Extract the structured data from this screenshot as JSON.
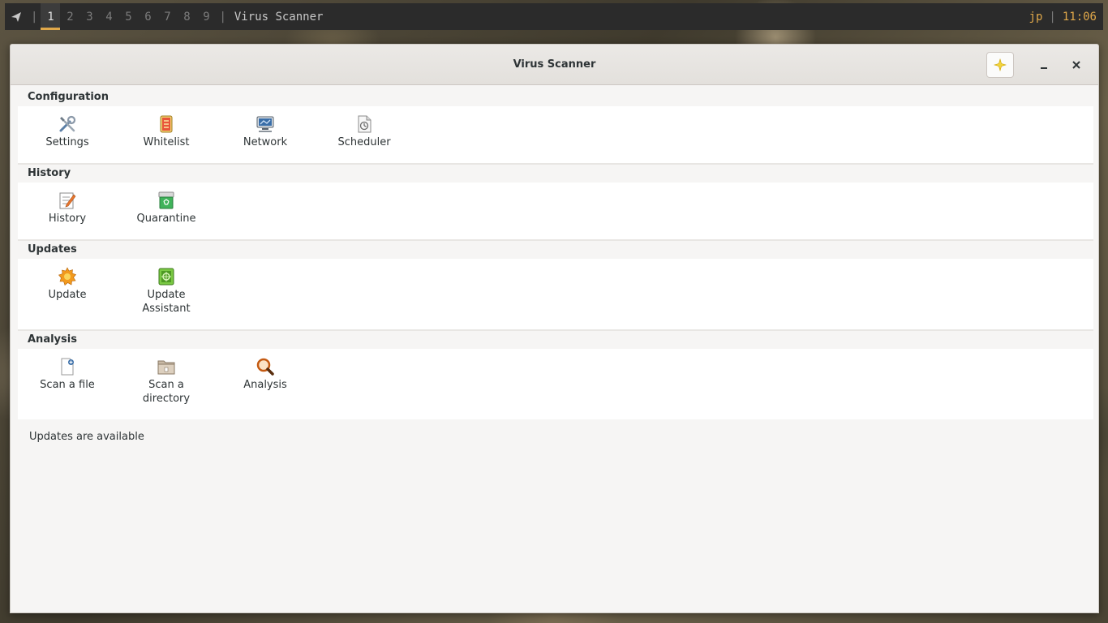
{
  "topbar": {
    "workspaces": [
      "1",
      "2",
      "3",
      "4",
      "5",
      "6",
      "7",
      "8",
      "9"
    ],
    "active_workspace": "1",
    "window_title": "Virus Scanner",
    "user": "jp",
    "time": "11:06",
    "accent_color": "#e0a84a"
  },
  "window": {
    "title": "Virus Scanner"
  },
  "sections": {
    "configuration": {
      "title": "Configuration",
      "items": [
        {
          "label": "Settings",
          "icon": "tools-icon"
        },
        {
          "label": "Whitelist",
          "icon": "whitelist-icon"
        },
        {
          "label": "Network",
          "icon": "network-icon"
        },
        {
          "label": "Scheduler",
          "icon": "scheduler-icon"
        }
      ]
    },
    "history": {
      "title": "History",
      "items": [
        {
          "label": "History",
          "icon": "history-notepad-icon"
        },
        {
          "label": "Quarantine",
          "icon": "quarantine-icon"
        }
      ]
    },
    "updates": {
      "title": "Updates",
      "items": [
        {
          "label": "Update",
          "icon": "update-gear-icon"
        },
        {
          "label": "Update\nAssistant",
          "icon": "update-assistant-icon"
        }
      ]
    },
    "analysis": {
      "title": "Analysis",
      "items": [
        {
          "label": "Scan a file",
          "icon": "scan-file-icon"
        },
        {
          "label": "Scan a\ndirectory",
          "icon": "scan-directory-icon"
        },
        {
          "label": "Analysis",
          "icon": "magnifier-icon"
        }
      ]
    }
  },
  "status": "Updates are available"
}
